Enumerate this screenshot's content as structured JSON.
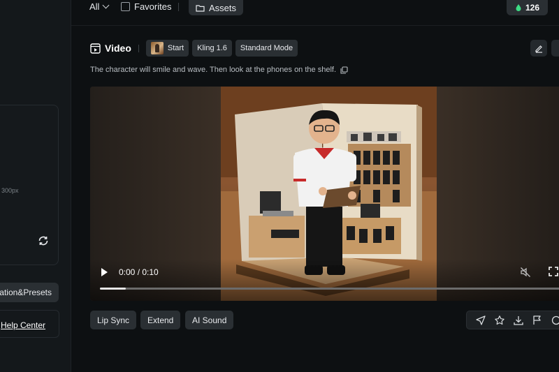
{
  "left_panel": {
    "size_hint": "300px",
    "presets_label": "Generation&Presets",
    "help_label": "Help Center"
  },
  "topbar": {
    "filter_label": "All",
    "favorites_label": "Favorites",
    "assets_label": "Assets",
    "credits": "126"
  },
  "header": {
    "title": "Video",
    "tags": [
      "Start",
      "Kling 1.6",
      "Standard Mode"
    ]
  },
  "prompt": "The character will smile and wave. Then look at the phones on the shelf.",
  "player": {
    "time": "0:00 / 0:10",
    "progress": 0.055
  },
  "actions": [
    "Lip Sync",
    "Extend",
    "AI Sound"
  ],
  "colors": {
    "accent_green": "#3ddc84",
    "surface": "#2a2f33",
    "background": "#0d1012"
  },
  "icons": [
    "refresh-icon",
    "chevron-down-icon",
    "folder-icon",
    "coin-icon",
    "video-icon",
    "edit-icon",
    "copy-icon",
    "play-icon",
    "mute-icon",
    "fullscreen-icon",
    "share-icon",
    "star-icon",
    "download-icon",
    "flag-icon"
  ]
}
